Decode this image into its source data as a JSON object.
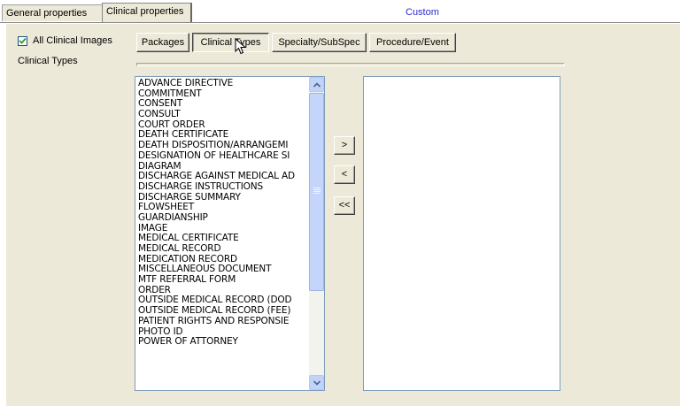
{
  "tabs": [
    {
      "label": "General properties"
    },
    {
      "label": "Clinical properties"
    }
  ],
  "custom_label": "Custom",
  "all_clinical_images": {
    "label": "All Clinical Images",
    "checked": true
  },
  "clinical_types_label": "Clinical Types",
  "filter_buttons": [
    {
      "label": "Packages"
    },
    {
      "label": "Clinical Types"
    },
    {
      "label": "Specialty/SubSpec"
    },
    {
      "label": "Procedure/Event"
    }
  ],
  "available_list": [
    "ADVANCE DIRECTIVE",
    "COMMITMENT",
    "CONSENT",
    "CONSULT",
    "COURT ORDER",
    "DEATH CERTIFICATE",
    "DEATH DISPOSITION/ARRANGEMI",
    "DESIGNATION OF HEALTHCARE SI",
    "DIAGRAM",
    "DISCHARGE AGAINST MEDICAL AD",
    "DISCHARGE INSTRUCTIONS",
    "DISCHARGE SUMMARY",
    "FLOWSHEET",
    "GUARDIANSHIP",
    "IMAGE",
    "MEDICAL CERTIFICATE",
    "MEDICAL RECORD",
    "MEDICATION RECORD",
    "MISCELLANEOUS DOCUMENT",
    "MTF REFERRAL FORM",
    "ORDER",
    "OUTSIDE MEDICAL RECORD (DOD",
    "OUTSIDE MEDICAL RECORD (FEE)",
    "PATIENT RIGHTS AND RESPONSIE",
    "PHOTO ID",
    "POWER OF ATTORNEY"
  ],
  "move_buttons": {
    "add": ">",
    "remove": "<",
    "remove_all": "<<"
  },
  "selected_list": []
}
